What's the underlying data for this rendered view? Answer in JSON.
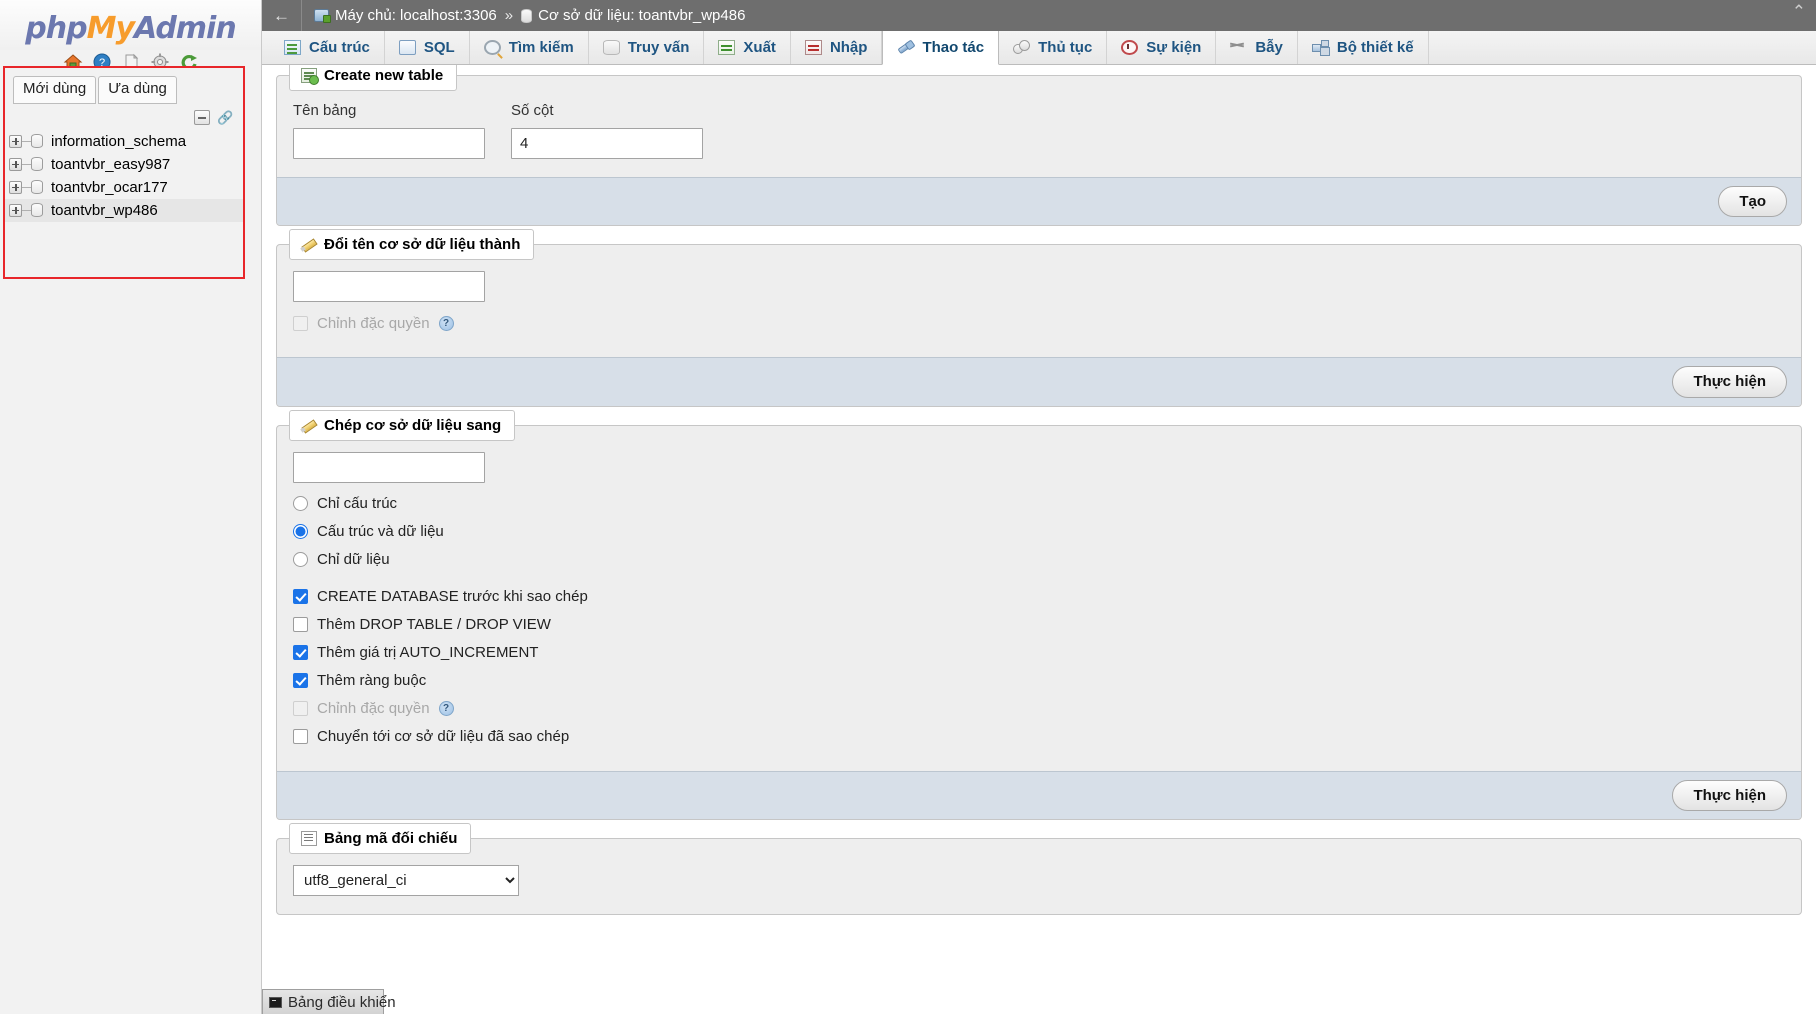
{
  "app": {
    "logo_php": "php",
    "logo_my": "My",
    "logo_admin": "Admin"
  },
  "sidebar": {
    "nav_icons": [
      "home-icon",
      "help-icon",
      "docs-icon",
      "settings-icon",
      "reload-icon"
    ],
    "tabs": [
      {
        "label": "Mới dùng",
        "name": "recent"
      },
      {
        "label": "Ưa dùng",
        "name": "favorites"
      }
    ],
    "tree_controls": [
      "collapse-all-icon",
      "link-with-main-panel-icon"
    ],
    "databases": [
      {
        "label": "information_schema",
        "selected": false
      },
      {
        "label": "toantvbr_easy987",
        "selected": false
      },
      {
        "label": "toantvbr_ocar177",
        "selected": false
      },
      {
        "label": "toantvbr_wp486",
        "selected": true
      }
    ]
  },
  "breadcrumb": {
    "back": "←",
    "server": "Máy chủ: localhost:3306",
    "separator": "»",
    "database": "Cơ sở dữ liệu: toantvbr_wp486",
    "collapse": "⌃"
  },
  "tabs": [
    {
      "label": "Cấu trúc",
      "icon": "ti-structure",
      "name": "tab-structure",
      "active": false
    },
    {
      "label": "SQL",
      "icon": "ti-sql",
      "name": "tab-sql",
      "active": false
    },
    {
      "label": "Tìm kiếm",
      "icon": "ti-search",
      "name": "tab-search",
      "active": false
    },
    {
      "label": "Truy vấn",
      "icon": "ti-query",
      "name": "tab-query",
      "active": false
    },
    {
      "label": "Xuất",
      "icon": "ti-export",
      "name": "tab-export",
      "active": false
    },
    {
      "label": "Nhập",
      "icon": "ti-import",
      "name": "tab-import",
      "active": false
    },
    {
      "label": "Thao tác",
      "icon": "ti-operations",
      "name": "tab-operations",
      "active": true
    },
    {
      "label": "Thủ tục",
      "icon": "ti-routines",
      "name": "tab-routines",
      "active": false
    },
    {
      "label": "Sự kiện",
      "icon": "ti-events",
      "name": "tab-events",
      "active": false
    },
    {
      "label": "Bẫy",
      "icon": "ti-triggers",
      "name": "tab-triggers",
      "active": false
    },
    {
      "label": "Bộ thiết kế",
      "icon": "ti-designer",
      "name": "tab-designer",
      "active": false
    }
  ],
  "create_table": {
    "legend": "Create new table",
    "table_name_label": "Tên bảng",
    "table_name_value": "",
    "table_name_placeholder": "",
    "num_columns_label": "Số cột",
    "num_columns_value": "4",
    "submit_label": "Tạo"
  },
  "rename_db": {
    "legend": "Đổi tên cơ sở dữ liệu thành",
    "value": "",
    "adjust_privileges_label": "Chỉnh đặc quyền",
    "help_glyph": "?",
    "submit_label": "Thực hiện"
  },
  "copy_db": {
    "legend": "Chép cơ sở dữ liệu sang",
    "value": "",
    "radios": [
      {
        "label": "Chỉ cấu trúc",
        "checked": false
      },
      {
        "label": "Cấu trúc và dữ liệu",
        "checked": true
      },
      {
        "label": "Chỉ dữ liệu",
        "checked": false
      }
    ],
    "checkboxes": [
      {
        "label": "CREATE DATABASE trước khi sao chép",
        "checked": true,
        "disabled": false,
        "help": false
      },
      {
        "label": "Thêm DROP TABLE / DROP VIEW",
        "checked": false,
        "disabled": false,
        "help": false
      },
      {
        "label": "Thêm giá trị AUTO_INCREMENT",
        "checked": true,
        "disabled": false,
        "help": false
      },
      {
        "label": "Thêm ràng buộc",
        "checked": true,
        "disabled": false,
        "help": false
      },
      {
        "label": "Chỉnh đặc quyền",
        "checked": false,
        "disabled": true,
        "help": true
      },
      {
        "label": "Chuyển tới cơ sở dữ liệu đã sao chép",
        "checked": false,
        "disabled": false,
        "help": false
      }
    ],
    "help_glyph": "?",
    "submit_label": "Thực hiện"
  },
  "collation": {
    "legend": "Bảng mã đối chiếu",
    "selected": "utf8_general_ci"
  },
  "console": {
    "label": "Bảng điều khiển"
  },
  "colors": {
    "accent": "#1a73e8",
    "highlight_border": "#e8262a",
    "tab_text": "#1f5582",
    "panel_bg": "#eeeeee",
    "footer_bg": "#d7dfe8",
    "breadcrumb_bg": "#6e6e6e"
  }
}
